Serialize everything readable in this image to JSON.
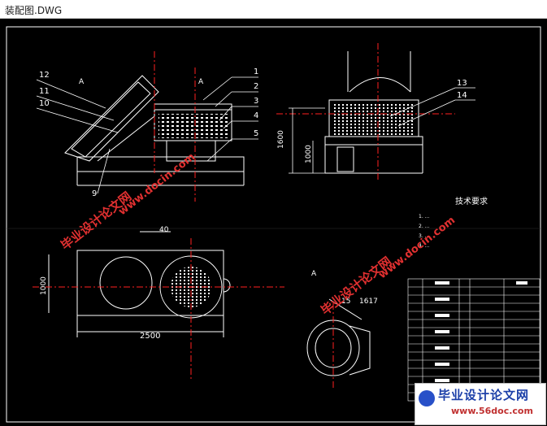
{
  "window": {
    "title": "装配图.DWG"
  },
  "drawing": {
    "part_numbers_top": [
      "1",
      "2",
      "3",
      "4",
      "5"
    ],
    "part_numbers_left": [
      "12",
      "11",
      "10"
    ],
    "part_9": "9",
    "part_13": "13",
    "part_14": "14",
    "part_15": "15",
    "part_1617": "1617",
    "view_a": "A",
    "dim_1600": "1600",
    "dim_1000_side": "1000",
    "dim_1000_plan": "1000",
    "dim_2500": "2500",
    "dim_40": "40",
    "tech_title": "技术要求",
    "tech_lines": [
      "1. ...",
      "2. ...",
      "3. ...",
      "4. ..."
    ]
  },
  "watermarks": {
    "cn": "毕业设计论文网",
    "url": "www.docin.com"
  },
  "footer": {
    "brand": "毕业设计论文网",
    "url": "www.56doc.com"
  },
  "colors": {
    "background": "#000000",
    "lines": "#ffffff",
    "center": "#ff2020",
    "watermark": "#e03030"
  }
}
